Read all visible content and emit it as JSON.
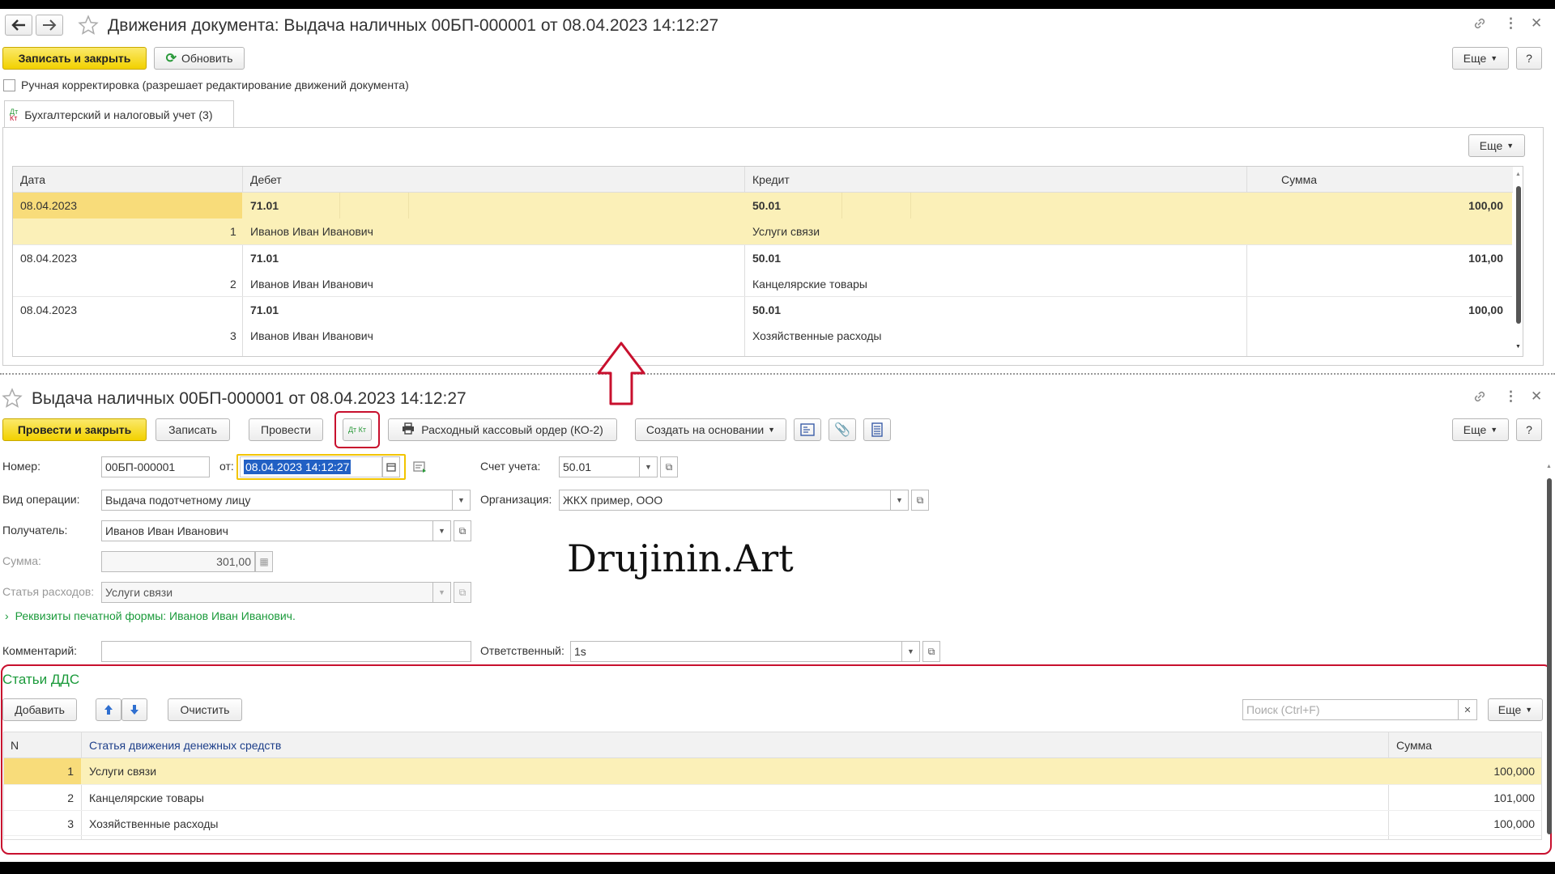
{
  "top": {
    "title": "Движения документа: Выдача наличных 00БП-000001 от 08.04.2023 14:12:27",
    "save_close": "Записать и закрыть",
    "refresh": "Обновить",
    "more": "Еще",
    "help": "?",
    "manual_checkbox_label": "Ручная корректировка (разрешает редактирование движений документа)",
    "tab_label": "Бухгалтерский и налоговый учет (3)",
    "table_more": "Еще",
    "columns": {
      "date": "Дата",
      "debit": "Дебет",
      "credit": "Кредит",
      "sum": "Сумма"
    },
    "rows": [
      {
        "date": "08.04.2023",
        "num": "1",
        "debit": "71.01",
        "debit_sub": "Иванов Иван Иванович",
        "credit": "50.01",
        "credit_sub": "Услуги связи",
        "sum": "100,00"
      },
      {
        "date": "08.04.2023",
        "num": "2",
        "debit": "71.01",
        "debit_sub": "Иванов Иван Иванович",
        "credit": "50.01",
        "credit_sub": "Канцелярские товары",
        "sum": "101,00"
      },
      {
        "date": "08.04.2023",
        "num": "3",
        "debit": "71.01",
        "debit_sub": "Иванов Иван Иванович",
        "credit": "50.01",
        "credit_sub": "Хозяйственные расходы",
        "sum": "100,00"
      }
    ]
  },
  "doc": {
    "title": "Выдача наличных 00БП-000001 от 08.04.2023 14:12:27",
    "post_close": "Провести и закрыть",
    "write": "Записать",
    "post": "Провести",
    "dtkt_icon": "Дт Кт",
    "print_order": "Расходный кассовый ордер (КО-2)",
    "create_based": "Создать на основании",
    "more": "Еще",
    "help": "?",
    "number_label": "Номер:",
    "number_value": "00БП-000001",
    "from_label": "от:",
    "date_value": "08.04.2023 14:12:27",
    "account_label": "Счет учета:",
    "account_value": "50.01",
    "operation_label": "Вид операции:",
    "operation_value": "Выдача подотчетному лицу",
    "org_label": "Организация:",
    "org_value": "ЖКХ пример, ООО",
    "recipient_label": "Получатель:",
    "recipient_value": "Иванов Иван Иванович",
    "sum_label": "Сумма:",
    "sum_value": "301,00",
    "expense_label": "Статья расходов:",
    "expense_value": "Услуги связи",
    "requisites_link": "Реквизиты печатной формы: Иванов Иван Иванович.",
    "comment_label": "Комментарий:",
    "comment_value": "",
    "responsible_label": "Ответственный:",
    "responsible_value": "1s",
    "watermark": "Drujinin.Art"
  },
  "dds": {
    "title": "Статьи ДДС",
    "add": "Добавить",
    "clear": "Очистить",
    "search_placeholder": "Поиск (Ctrl+F)",
    "more": "Еще",
    "columns": {
      "n": "N",
      "item": "Статья движения денежных средств",
      "sum": "Сумма"
    },
    "rows": [
      {
        "n": "1",
        "item": "Услуги связи",
        "sum": "100,000"
      },
      {
        "n": "2",
        "item": "Канцелярские товары",
        "sum": "101,000"
      },
      {
        "n": "3",
        "item": "Хозяйственные расходы",
        "sum": "100,000"
      }
    ]
  },
  "colors": {
    "accent_yellow": "#f2d100",
    "selected_row": "#fbf0b8",
    "highlight_red": "#c8102e",
    "link_green": "#1a9a3a"
  }
}
